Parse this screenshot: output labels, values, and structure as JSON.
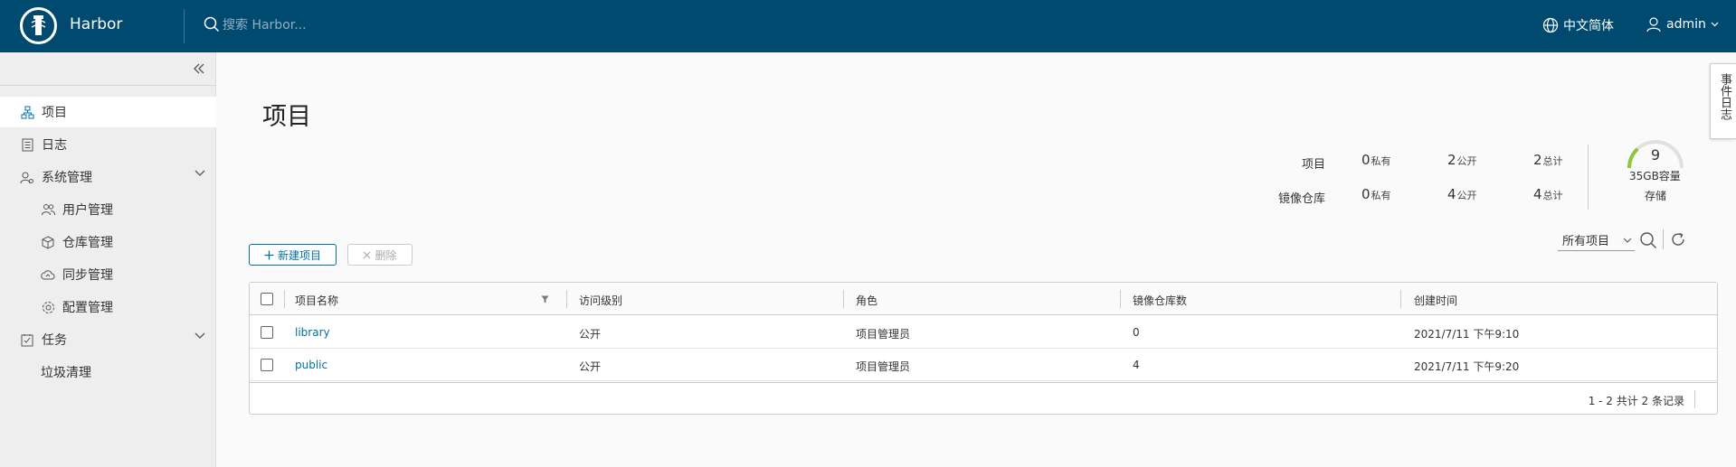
{
  "header": {
    "brand": "Harbor",
    "search_placeholder": "搜索 Harbor...",
    "language": "中文简体",
    "user": "admin"
  },
  "sidebar": {
    "items": [
      {
        "label": "项目",
        "icon": "project-icon"
      },
      {
        "label": "日志",
        "icon": "log-icon"
      },
      {
        "label": "系统管理",
        "icon": "admin-icon"
      },
      {
        "label": "用户管理",
        "icon": "users-icon"
      },
      {
        "label": "仓库管理",
        "icon": "registry-icon"
      },
      {
        "label": "同步管理",
        "icon": "replication-icon"
      },
      {
        "label": "配置管理",
        "icon": "config-icon"
      },
      {
        "label": "任务",
        "icon": "tasks-icon"
      },
      {
        "label": "垃圾清理"
      }
    ]
  },
  "main": {
    "title": "项目",
    "event_tab": "事件日志",
    "stats": {
      "projects_label": "项目",
      "repos_label": "镜像仓库",
      "private_suffix": "私有",
      "public_suffix": "公开",
      "total_suffix": "总计",
      "projects": {
        "private": "0",
        "public": "2",
        "total": "2"
      },
      "repos": {
        "private": "0",
        "public": "4",
        "total": "4"
      }
    },
    "storage": {
      "count": "9",
      "capacity": "35GB容量",
      "label": "存储",
      "used_fraction": 0.26,
      "accent": "#8dc53e"
    },
    "toolbar": {
      "new_project": "新建项目",
      "delete": "删除",
      "filter": "所有项目"
    },
    "table": {
      "headers": [
        "项目名称",
        "访问级别",
        "角色",
        "镜像仓库数",
        "创建时间"
      ],
      "rows": [
        {
          "name": "library",
          "access": "公开",
          "role": "项目管理员",
          "repos": "0",
          "created": "2021/7/11 下午9:10"
        },
        {
          "name": "public",
          "access": "公开",
          "role": "项目管理员",
          "repos": "4",
          "created": "2021/7/11 下午9:20"
        }
      ],
      "footer": "1 - 2 共计 2 条记录"
    }
  },
  "colors": {
    "header_bg": "#004a70",
    "link": "#0072a3",
    "accent": "#8dc53e"
  }
}
